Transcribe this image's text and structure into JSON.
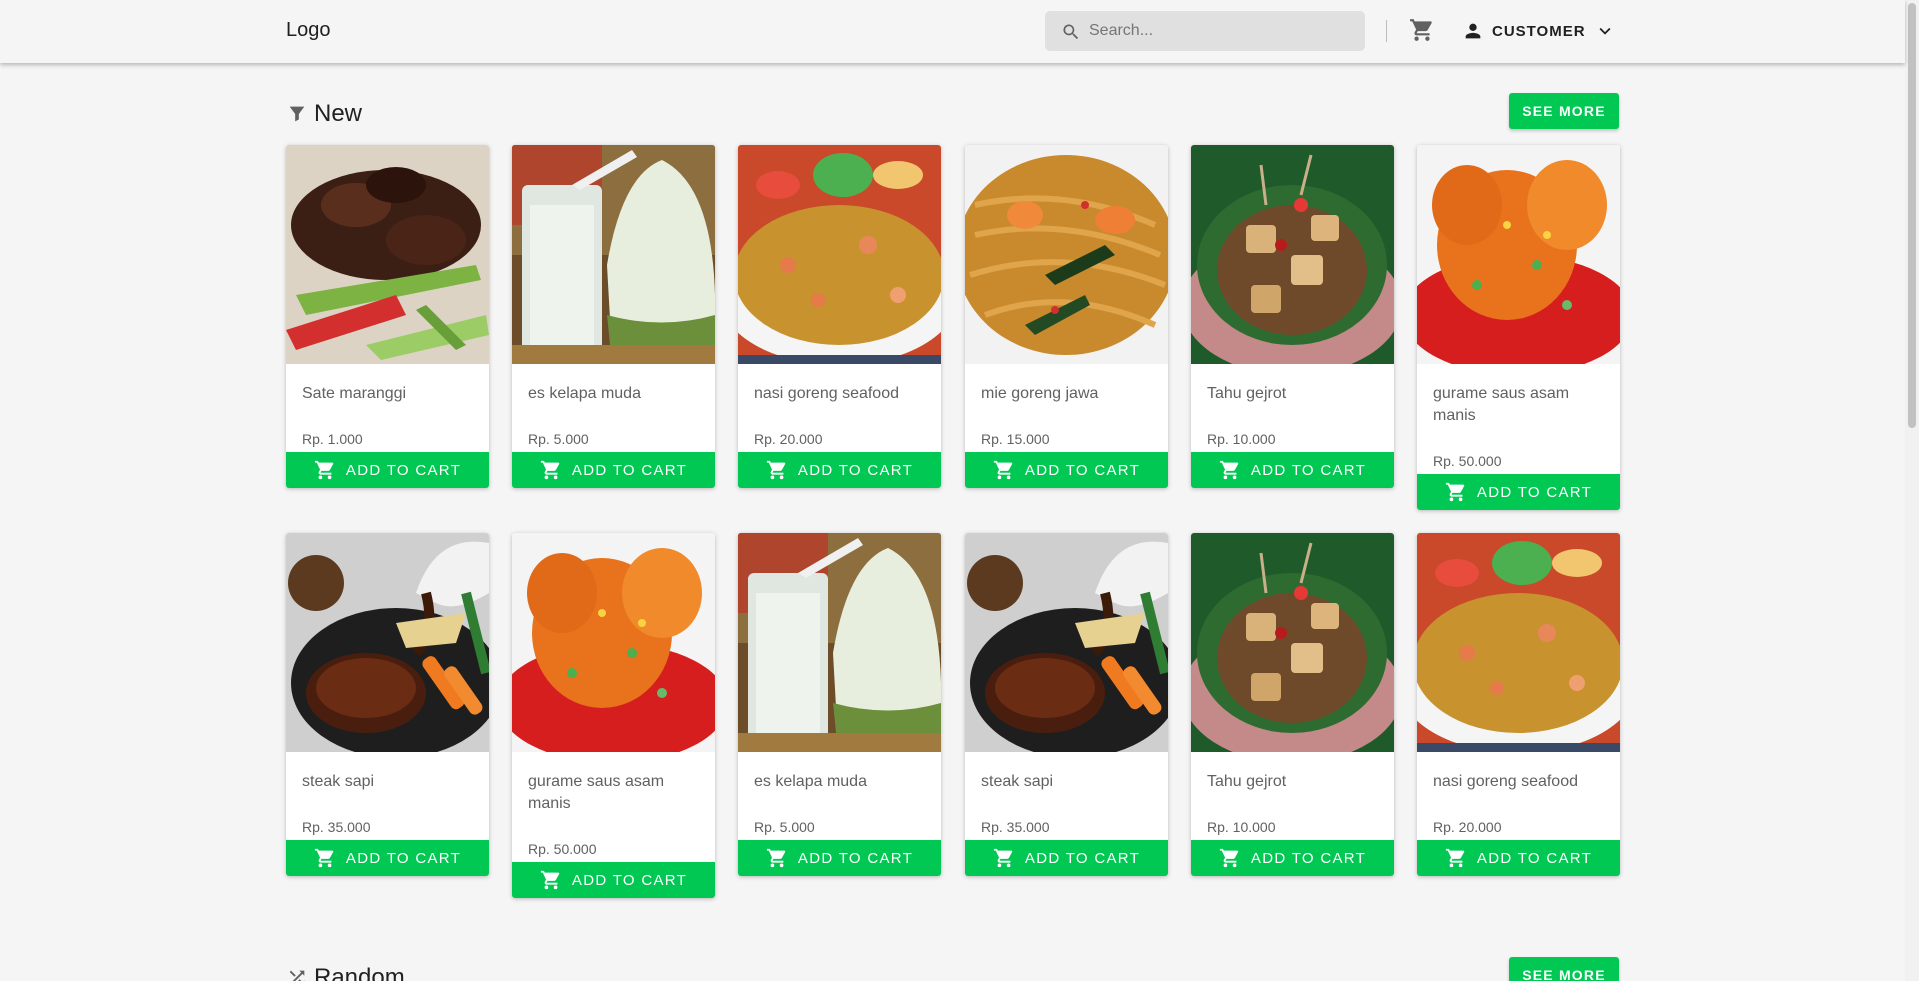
{
  "header": {
    "logo": "Logo",
    "search_placeholder": "Search...",
    "user_label": "CUSTOMER",
    "icons": {
      "search": "search-icon",
      "cart": "cart-icon",
      "user": "person-icon",
      "dropdown": "chevron-down-icon"
    }
  },
  "sections": [
    {
      "title": "New",
      "icon": "filter-icon",
      "see_more": "SEE MORE",
      "items": [
        {
          "name": "Sate maranggi",
          "price": "Rp. 1.000",
          "image": "satay"
        },
        {
          "name": "es kelapa muda",
          "price": "Rp. 5.000",
          "image": "coconut"
        },
        {
          "name": "nasi goreng seafood",
          "price": "Rp. 20.000",
          "image": "friedrice"
        },
        {
          "name": "mie goreng jawa",
          "price": "Rp. 15.000",
          "image": "noodles"
        },
        {
          "name": "Tahu gejrot",
          "price": "Rp. 10.000",
          "image": "tofu"
        },
        {
          "name": "gurame saus asam manis",
          "price": "Rp. 50.000",
          "image": "gurame"
        },
        {
          "name": "steak sapi",
          "price": "Rp. 35.000",
          "image": "steak"
        },
        {
          "name": "gurame saus asam manis",
          "price": "Rp. 50.000",
          "image": "gurame"
        },
        {
          "name": "es kelapa muda",
          "price": "Rp. 5.000",
          "image": "coconut"
        },
        {
          "name": "steak sapi",
          "price": "Rp. 35.000",
          "image": "steak"
        },
        {
          "name": "Tahu gejrot",
          "price": "Rp. 10.000",
          "image": "tofu"
        },
        {
          "name": "nasi goreng seafood",
          "price": "Rp. 20.000",
          "image": "friedrice"
        }
      ]
    },
    {
      "title": "Random",
      "icon": "shuffle-icon",
      "see_more": "SEE MORE"
    }
  ],
  "add_to_cart_label": "ADD TO CART",
  "colors": {
    "accent": "#00c853",
    "background": "#f5f5f5",
    "text_muted": "#616161"
  }
}
